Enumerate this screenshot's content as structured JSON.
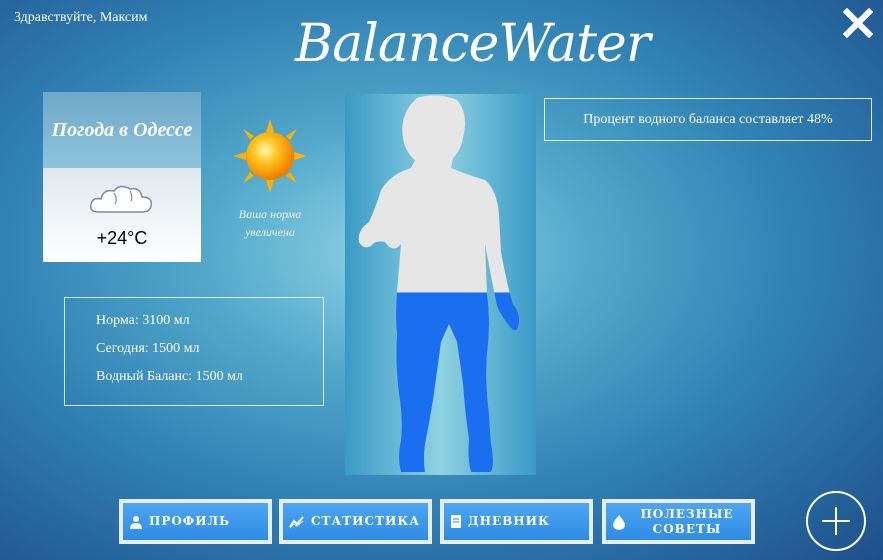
{
  "header": {
    "greeting": "Здравствуйте, Максим",
    "logo": "BalanceWater",
    "close_icon": "close-icon"
  },
  "weather": {
    "title": "Погода в Одессе",
    "temperature": "+24°C",
    "icon": "cloud-icon"
  },
  "sun": {
    "icon": "sun-icon",
    "message": "Ваша норма увеличена"
  },
  "stats": {
    "norm": "Норма: 3100 мл",
    "today": "Сегодня: 1500 мл",
    "balance": "Водный Баланс: 1500 мл"
  },
  "body_figure": {
    "fill_percent": 48,
    "fill_color": "#1a6ff0",
    "empty_color": "#e6e6e6"
  },
  "percent_box": {
    "text": "Процент водного баланса составляет 48%"
  },
  "nav": {
    "profile": "ПРОФИЛЬ",
    "statistics": "СТАТИСТИКА",
    "diary": "ДНЕВНИК",
    "tips": "ПОЛЕЗНЫЕ СОВЕТЫ"
  },
  "add_button_icon": "plus-icon",
  "colors": {
    "button_blue": "#3d9bec",
    "water_blue": "#1a6ff0"
  }
}
